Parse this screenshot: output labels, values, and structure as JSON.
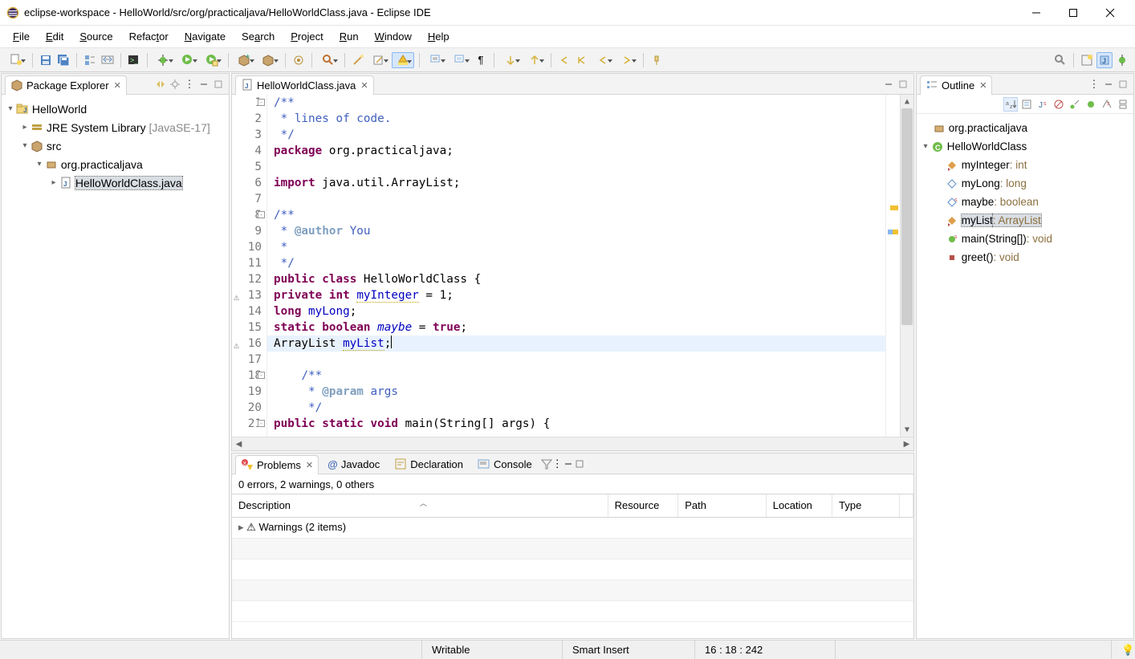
{
  "window_title": "eclipse-workspace - HelloWorld/src/org/practicaljava/HelloWorldClass.java - Eclipse IDE",
  "menu": [
    "File",
    "Edit",
    "Source",
    "Refactor",
    "Navigate",
    "Search",
    "Project",
    "Run",
    "Window",
    "Help"
  ],
  "package_explorer": {
    "title": "Package Explorer",
    "tree": {
      "project": "HelloWorld",
      "jre": "JRE System Library",
      "jre_version": "[JavaSE-17]",
      "src": "src",
      "pkg": "org.practicaljava",
      "file": "HelloWorldClass.java"
    }
  },
  "editor": {
    "tab": "HelloWorldClass.java",
    "lines": [
      {
        "n": 1,
        "fold": "-",
        "c": [
          [
            "cmt",
            "/**"
          ]
        ]
      },
      {
        "n": 2,
        "c": [
          [
            "cmt",
            " * lines of code."
          ]
        ]
      },
      {
        "n": 3,
        "c": [
          [
            "cmt",
            " */"
          ]
        ]
      },
      {
        "n": 4,
        "c": [
          [
            "kw",
            "package"
          ],
          [
            "",
            " org.practicaljava;"
          ]
        ]
      },
      {
        "n": 5,
        "c": []
      },
      {
        "n": 6,
        "c": [
          [
            "kw",
            "import"
          ],
          [
            "",
            " java.util.ArrayList;"
          ]
        ]
      },
      {
        "n": 7,
        "c": []
      },
      {
        "n": 8,
        "fold": "-",
        "c": [
          [
            "cmt",
            "/**"
          ]
        ]
      },
      {
        "n": 9,
        "c": [
          [
            "cmt",
            " * "
          ],
          [
            "tag",
            "@author"
          ],
          [
            "cmt",
            " You"
          ]
        ]
      },
      {
        "n": 10,
        "c": [
          [
            "cmt",
            " *"
          ]
        ]
      },
      {
        "n": 11,
        "c": [
          [
            "cmt",
            " */"
          ]
        ]
      },
      {
        "n": 12,
        "c": [
          [
            "kw",
            "public"
          ],
          [
            "",
            " "
          ],
          [
            "kw",
            "class"
          ],
          [
            "",
            " HelloWorldClass {"
          ]
        ]
      },
      {
        "n": 13,
        "warn": true,
        "c": [
          [
            "kw",
            "private"
          ],
          [
            "",
            " "
          ],
          [
            "kw",
            "int"
          ],
          [
            "",
            " "
          ],
          [
            "fldw",
            "myInteger"
          ],
          [
            "",
            " = 1;"
          ]
        ]
      },
      {
        "n": 14,
        "c": [
          [
            "kw",
            "long"
          ],
          [
            "",
            " "
          ],
          [
            "fld",
            "myLong"
          ],
          [
            "",
            ";"
          ]
        ]
      },
      {
        "n": 15,
        "c": [
          [
            "kw",
            "static"
          ],
          [
            "",
            " "
          ],
          [
            "kw",
            "boolean"
          ],
          [
            "",
            " "
          ],
          [
            "flditalic",
            "maybe"
          ],
          [
            "",
            " = "
          ],
          [
            "kw",
            "true"
          ],
          [
            "",
            ";"
          ]
        ]
      },
      {
        "n": 16,
        "warn": true,
        "highlight": true,
        "caret": true,
        "c": [
          [
            "",
            "ArrayList "
          ],
          [
            "fldw",
            "myList"
          ],
          [
            "",
            ";"
          ]
        ]
      },
      {
        "n": 17,
        "c": []
      },
      {
        "n": 18,
        "fold": "-",
        "c": [
          [
            "",
            "    "
          ],
          [
            "cmt",
            "/**"
          ]
        ]
      },
      {
        "n": 19,
        "c": [
          [
            "",
            "    "
          ],
          [
            "cmt",
            " * "
          ],
          [
            "tag",
            "@param"
          ],
          [
            "cmt",
            " args"
          ]
        ]
      },
      {
        "n": 20,
        "c": [
          [
            "",
            "    "
          ],
          [
            "cmt",
            " */"
          ]
        ]
      },
      {
        "n": 21,
        "fold": "-",
        "c": [
          [
            "kw",
            "public"
          ],
          [
            "",
            " "
          ],
          [
            "kw",
            "static"
          ],
          [
            "",
            " "
          ],
          [
            "kw",
            "void"
          ],
          [
            "",
            " main(String[] args) {"
          ]
        ]
      }
    ]
  },
  "outline": {
    "title": "Outline",
    "items": {
      "pkg": "org.practicaljava",
      "class": "HelloWorldClass",
      "members": [
        {
          "name": "myInteger",
          "type": "int"
        },
        {
          "name": "myLong",
          "type": "long"
        },
        {
          "name": "maybe",
          "type": "boolean"
        },
        {
          "name": "myList",
          "type": "ArrayList",
          "sel": true
        },
        {
          "name": "main(String[])",
          "type": "void"
        },
        {
          "name": "greet()",
          "type": "void"
        }
      ]
    }
  },
  "bottom": {
    "tabs": [
      "Problems",
      "Javadoc",
      "Declaration",
      "Console"
    ],
    "summary": "0 errors, 2 warnings, 0 others",
    "columns": [
      "Description",
      "Resource",
      "Path",
      "Location",
      "Type"
    ],
    "warn_row": "Warnings (2 items)"
  },
  "status": {
    "state": "Writable",
    "insert": "Smart Insert",
    "cursor": "16 : 18 : 242"
  }
}
